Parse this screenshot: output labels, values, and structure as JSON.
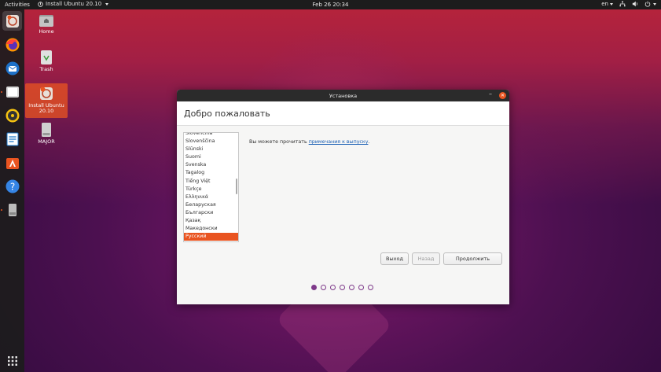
{
  "topbar": {
    "activities": "Activities",
    "app_name": "Install Ubuntu 20.10",
    "clock": "Feb 26  20:34",
    "input_lang": "en"
  },
  "desktop": {
    "icons": [
      {
        "label": "Home"
      },
      {
        "label": "Trash"
      },
      {
        "label": "Install Ubuntu 20.10"
      },
      {
        "label": "MAJOR"
      }
    ]
  },
  "window": {
    "title": "Установка",
    "heading": "Добро пожаловать",
    "languages": [
      "Slovenčina",
      "Slovenščina",
      "Slūnski",
      "Suomi",
      "Svenska",
      "Tagalog",
      "Tiếng Việt",
      "Türkçe",
      "Ελληνικά",
      "Беларуская",
      "Български",
      "Қазақ",
      "Македонски",
      "Русский"
    ],
    "selected_language": "Русский",
    "notes_prefix": "Вы можете прочитать ",
    "notes_link": "примечания к выпуску",
    "notes_suffix": ".",
    "buttons": {
      "quit": "Выход",
      "back": "Назад",
      "continue": "Продолжить"
    },
    "progress": {
      "current_step": 1,
      "total_steps": 7
    }
  },
  "colors": {
    "accent": "#e95420",
    "step_dot": "#7e3a8a",
    "topbar": "#1c1c1c"
  }
}
